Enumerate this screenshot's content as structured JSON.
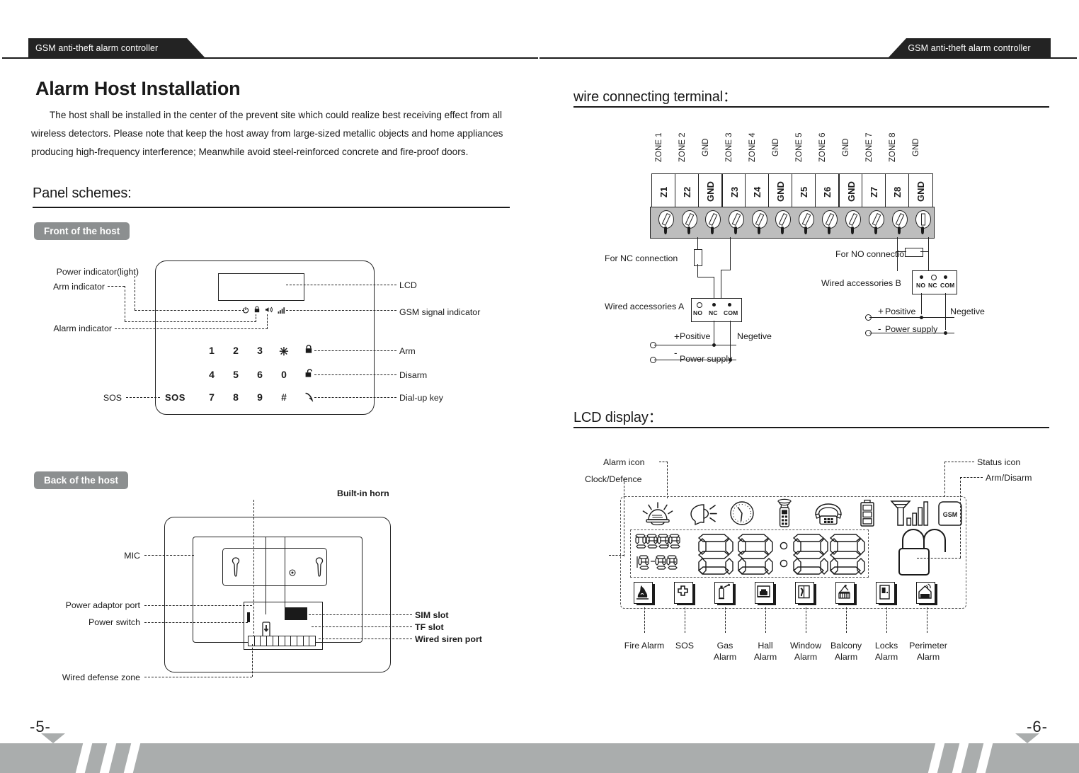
{
  "document": {
    "header_banner": "GSM anti-theft alarm controller",
    "left_page_number": "-5-",
    "right_page_number": "-6-"
  },
  "left_page": {
    "title": "Alarm Host Installation",
    "body": "The host shall be installed in the center of the prevent site which could realize best receiving effect from all wireless detectors. Please note that keep the host away from large-sized metallic objects and home appliances producing high-frequency interference; Meanwhile avoid steel-reinforced concrete and fire-proof doors.",
    "panel_section_title": "Panel schemes:",
    "front": {
      "pill": "Front of the host",
      "labels_left": [
        "Power  indicator(light)",
        "Arm indicator",
        "Alarm indicator",
        "SOS"
      ],
      "labels_right": [
        "LCD",
        "GSM signal indicator",
        "Arm",
        "Disarm",
        "Dial-up key"
      ],
      "keypad": {
        "row1": [
          "1",
          "2",
          "3",
          "✳"
        ],
        "row2": [
          "4",
          "5",
          "6",
          "0"
        ],
        "row3": [
          "7",
          "8",
          "9",
          "#"
        ],
        "sos_key": "SOS"
      },
      "indicator_icons": [
        "power-icon",
        "arm-lock-icon",
        "alarm-icon",
        "signal-bars-icon"
      ],
      "function_icons": [
        "lock-closed-icon",
        "lock-open-icon",
        "phone-handset-icon"
      ]
    },
    "back": {
      "pill": "Back of the host",
      "label_top": "Built-in horn",
      "labels_left": [
        "MIC",
        "Power adaptor port",
        "Power switch",
        "Wired defense zone"
      ],
      "labels_right": [
        "SIM slot",
        "TF slot",
        "Wired siren port"
      ]
    }
  },
  "right_page": {
    "terminal_section_title": "wire connecting terminal：",
    "terminal": {
      "zone_labels": [
        "ZONE 1",
        "ZONE 2",
        "GND",
        "ZONE 3",
        "ZONE 4",
        "GND",
        "ZONE 5",
        "ZONE 6",
        "GND",
        "ZONE 7",
        "ZONE 8",
        "GND"
      ],
      "pin_labels": [
        "Z1",
        "Z2",
        "GND",
        "Z3",
        "Z4",
        "GND",
        "Z5",
        "Z6",
        "GND",
        "Z7",
        "Z8",
        "GND"
      ]
    },
    "wiring": {
      "nc_label": "For NC connection",
      "no_label": "For NO connection",
      "accessory_a": "Wired accessories A",
      "accessory_b": "Wired accessories B",
      "terminal_pins": [
        "NO",
        "NC",
        "COM"
      ],
      "positive": "Positive",
      "negetive": "Negetive",
      "power_supply": "Power supply",
      "plus": "+",
      "minus": "-"
    },
    "lcd_section_title": "LCD display：",
    "lcd": {
      "callouts_left": [
        "Alarm icon",
        "Clock/Defence"
      ],
      "callouts_right": [
        "Status icon",
        "Arm/Disarm"
      ],
      "status_icons": [
        "alarm-siren-icon",
        "speaking-head-icon",
        "clock-icon",
        "remote-siren-icon",
        "telephone-icon",
        "battery-icon",
        "antenna-signal-icon",
        "gsm-sim-icon"
      ],
      "clock_defence": {
        "year": "2088",
        "date": "18-88",
        "time_hours": "88",
        "time_minutes": "88"
      },
      "arm_disarm_icon": "open-padlock-icon",
      "zone_icons": [
        "fire-alarm-icon",
        "sos-cross-icon",
        "gas-alarm-icon",
        "hall-alarm-icon",
        "window-alarm-icon",
        "balcony-alarm-icon",
        "locks-alarm-icon",
        "perimeter-alarm-icon"
      ],
      "zone_labels": [
        "Fire Alarm",
        "SOS",
        "Gas\nAlarm",
        "Hall\nAlarm",
        "Window\nAlarm",
        "Balcony\nAlarm",
        "Locks\nAlarm",
        "Perimeter\nAlarm"
      ]
    }
  },
  "colors": {
    "accent_blue": "#18a5e8",
    "banner_dark": "#232323",
    "pill_gray": "#8c8f90",
    "footer_gray": "#aaadad",
    "terminal_gray": "#bdbdbd"
  }
}
